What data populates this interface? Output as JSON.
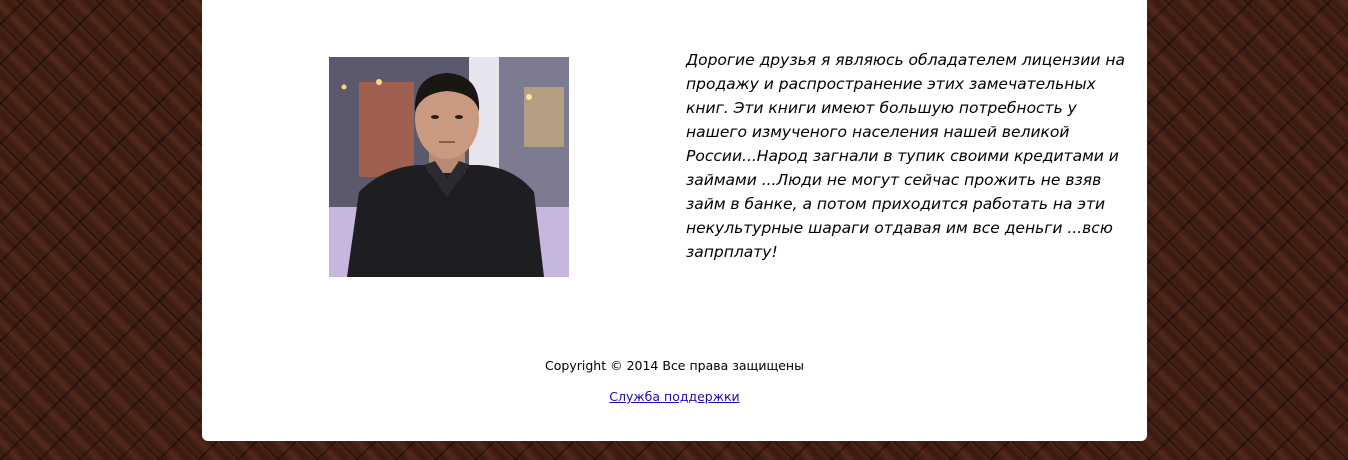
{
  "content": {
    "photo_alt": "portrait",
    "intro_text": "Дорогие друзья я являюсь обладателем лицензии на продажу и распространение этих замечательных книг. Эти книги имеют большую потребность у нашего измученого населения нашей великой России...Народ загнали в тупик своими кредитами и займами ...Люди не могут сейчас прожить не взяв займ в банке, а потом приходится работать на эти некультурные шараги отдавая им все деньги ...всю запрплату!"
  },
  "footer": {
    "copyright": "Copyright © 2014 Все права защищены",
    "support_link": "Служба поддержки"
  },
  "colors": {
    "background": "#3a1a10",
    "panel": "#ffffff",
    "link": "#1a0dab"
  }
}
